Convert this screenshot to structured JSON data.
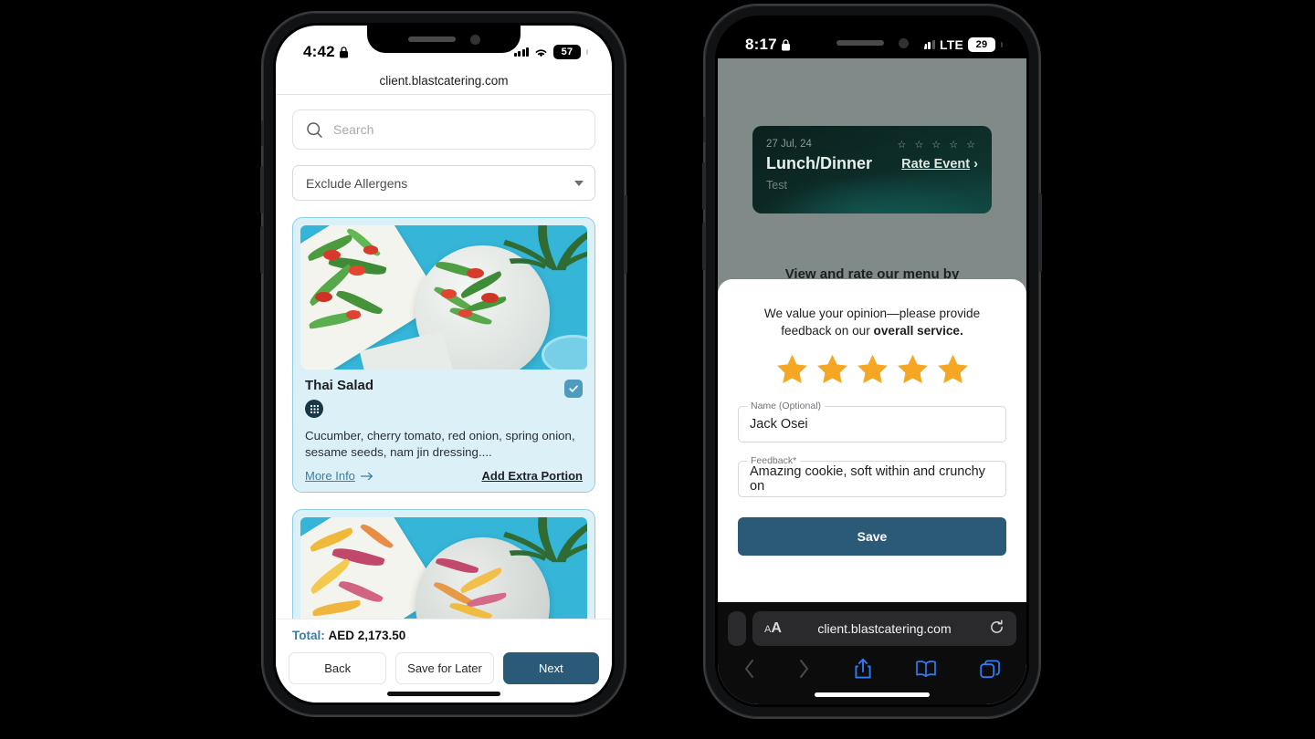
{
  "scene": {
    "background": "#000000",
    "accent_primary": "#2a5a77",
    "accent_link": "#3c7ea0",
    "card_bg": "#dcf0f8",
    "card_border": "#8fcde5",
    "star_color": "#f5a623",
    "event_card_bg": "#0d2c28"
  },
  "left_phone": {
    "status_bar": {
      "time": "4:42",
      "lock_icon": "lock-icon",
      "signal_icon": "cellular-bars-icon",
      "wifi_icon": "wifi-icon",
      "battery_level": "57"
    },
    "browser": {
      "url": "client.blastcatering.com"
    },
    "search": {
      "icon": "search-icon",
      "placeholder": "Search",
      "value": ""
    },
    "allergen_filter": {
      "label": "Exclude Allergens",
      "caret_icon": "chevron-down-icon"
    },
    "dishes": [
      {
        "name": "Thai Salad",
        "selected": true,
        "check_icon": "checkmark-icon",
        "allergen_icon": "allergen-badge-icon",
        "description": "Cucumber, cherry tomato, red onion, spring onion, sesame seeds, nam jin dressing....",
        "more_info_label": "More Info",
        "more_info_icon": "arrow-right-icon",
        "extra_portion_label": "Add Extra Portion",
        "image_alt": "thai-salad-photo"
      },
      {
        "name": "",
        "selected": false,
        "description": "",
        "image_alt": "fruit-salad-photo"
      }
    ],
    "footer": {
      "total_label": "Total:",
      "total_value": "AED 2,173.50",
      "back_label": "Back",
      "save_later_label": "Save for Later",
      "next_label": "Next"
    }
  },
  "right_phone": {
    "status_bar": {
      "time": "8:17",
      "lock_icon": "lock-icon",
      "signal_icon": "cellular-bars-icon",
      "network": "LTE",
      "battery_level": "29"
    },
    "event_card": {
      "date": "27 Jul, 24",
      "title": "Lunch/Dinner",
      "subtitle": "Test",
      "stars_empty": "☆ ☆ ☆ ☆ ☆",
      "rate_label": "Rate Event",
      "chevron_icon": "chevron-right-icon"
    },
    "page_heading": "View and rate our menu by",
    "modal": {
      "prompt_part1": "We value your opinion—please provide feedback on our ",
      "prompt_bold": "overall service.",
      "rating": 5,
      "max_rating": 5,
      "star_icon": "star-filled-icon",
      "name_field": {
        "label": "Name (Optional)",
        "value": "Jack Osei"
      },
      "feedback_field": {
        "label": "Feedback*",
        "value": "Amazing cookie, soft within and crunchy on"
      },
      "save_label": "Save"
    },
    "safari": {
      "text_size_label": "AA",
      "url": "client.blastcatering.com",
      "reload_icon": "reload-icon",
      "back_icon": "chevron-left-icon",
      "forward_icon": "chevron-right-icon",
      "share_icon": "share-icon",
      "bookmarks_icon": "book-icon",
      "tabs_icon": "tabs-icon"
    }
  }
}
